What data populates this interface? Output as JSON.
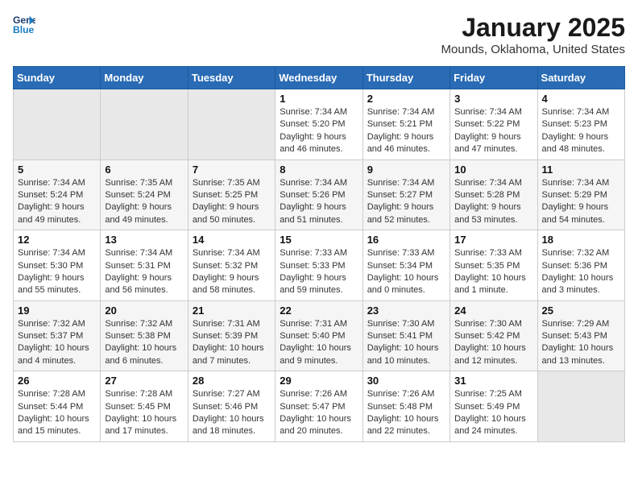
{
  "header": {
    "logo_line1": "General",
    "logo_line2": "Blue",
    "month": "January 2025",
    "location": "Mounds, Oklahoma, United States"
  },
  "weekdays": [
    "Sunday",
    "Monday",
    "Tuesday",
    "Wednesday",
    "Thursday",
    "Friday",
    "Saturday"
  ],
  "weeks": [
    [
      {
        "day": "",
        "info": ""
      },
      {
        "day": "",
        "info": ""
      },
      {
        "day": "",
        "info": ""
      },
      {
        "day": "1",
        "info": "Sunrise: 7:34 AM\nSunset: 5:20 PM\nDaylight: 9 hours\nand 46 minutes."
      },
      {
        "day": "2",
        "info": "Sunrise: 7:34 AM\nSunset: 5:21 PM\nDaylight: 9 hours\nand 46 minutes."
      },
      {
        "day": "3",
        "info": "Sunrise: 7:34 AM\nSunset: 5:22 PM\nDaylight: 9 hours\nand 47 minutes."
      },
      {
        "day": "4",
        "info": "Sunrise: 7:34 AM\nSunset: 5:23 PM\nDaylight: 9 hours\nand 48 minutes."
      }
    ],
    [
      {
        "day": "5",
        "info": "Sunrise: 7:34 AM\nSunset: 5:24 PM\nDaylight: 9 hours\nand 49 minutes."
      },
      {
        "day": "6",
        "info": "Sunrise: 7:35 AM\nSunset: 5:24 PM\nDaylight: 9 hours\nand 49 minutes."
      },
      {
        "day": "7",
        "info": "Sunrise: 7:35 AM\nSunset: 5:25 PM\nDaylight: 9 hours\nand 50 minutes."
      },
      {
        "day": "8",
        "info": "Sunrise: 7:34 AM\nSunset: 5:26 PM\nDaylight: 9 hours\nand 51 minutes."
      },
      {
        "day": "9",
        "info": "Sunrise: 7:34 AM\nSunset: 5:27 PM\nDaylight: 9 hours\nand 52 minutes."
      },
      {
        "day": "10",
        "info": "Sunrise: 7:34 AM\nSunset: 5:28 PM\nDaylight: 9 hours\nand 53 minutes."
      },
      {
        "day": "11",
        "info": "Sunrise: 7:34 AM\nSunset: 5:29 PM\nDaylight: 9 hours\nand 54 minutes."
      }
    ],
    [
      {
        "day": "12",
        "info": "Sunrise: 7:34 AM\nSunset: 5:30 PM\nDaylight: 9 hours\nand 55 minutes."
      },
      {
        "day": "13",
        "info": "Sunrise: 7:34 AM\nSunset: 5:31 PM\nDaylight: 9 hours\nand 56 minutes."
      },
      {
        "day": "14",
        "info": "Sunrise: 7:34 AM\nSunset: 5:32 PM\nDaylight: 9 hours\nand 58 minutes."
      },
      {
        "day": "15",
        "info": "Sunrise: 7:33 AM\nSunset: 5:33 PM\nDaylight: 9 hours\nand 59 minutes."
      },
      {
        "day": "16",
        "info": "Sunrise: 7:33 AM\nSunset: 5:34 PM\nDaylight: 10 hours\nand 0 minutes."
      },
      {
        "day": "17",
        "info": "Sunrise: 7:33 AM\nSunset: 5:35 PM\nDaylight: 10 hours\nand 1 minute."
      },
      {
        "day": "18",
        "info": "Sunrise: 7:32 AM\nSunset: 5:36 PM\nDaylight: 10 hours\nand 3 minutes."
      }
    ],
    [
      {
        "day": "19",
        "info": "Sunrise: 7:32 AM\nSunset: 5:37 PM\nDaylight: 10 hours\nand 4 minutes."
      },
      {
        "day": "20",
        "info": "Sunrise: 7:32 AM\nSunset: 5:38 PM\nDaylight: 10 hours\nand 6 minutes."
      },
      {
        "day": "21",
        "info": "Sunrise: 7:31 AM\nSunset: 5:39 PM\nDaylight: 10 hours\nand 7 minutes."
      },
      {
        "day": "22",
        "info": "Sunrise: 7:31 AM\nSunset: 5:40 PM\nDaylight: 10 hours\nand 9 minutes."
      },
      {
        "day": "23",
        "info": "Sunrise: 7:30 AM\nSunset: 5:41 PM\nDaylight: 10 hours\nand 10 minutes."
      },
      {
        "day": "24",
        "info": "Sunrise: 7:30 AM\nSunset: 5:42 PM\nDaylight: 10 hours\nand 12 minutes."
      },
      {
        "day": "25",
        "info": "Sunrise: 7:29 AM\nSunset: 5:43 PM\nDaylight: 10 hours\nand 13 minutes."
      }
    ],
    [
      {
        "day": "26",
        "info": "Sunrise: 7:28 AM\nSunset: 5:44 PM\nDaylight: 10 hours\nand 15 minutes."
      },
      {
        "day": "27",
        "info": "Sunrise: 7:28 AM\nSunset: 5:45 PM\nDaylight: 10 hours\nand 17 minutes."
      },
      {
        "day": "28",
        "info": "Sunrise: 7:27 AM\nSunset: 5:46 PM\nDaylight: 10 hours\nand 18 minutes."
      },
      {
        "day": "29",
        "info": "Sunrise: 7:26 AM\nSunset: 5:47 PM\nDaylight: 10 hours\nand 20 minutes."
      },
      {
        "day": "30",
        "info": "Sunrise: 7:26 AM\nSunset: 5:48 PM\nDaylight: 10 hours\nand 22 minutes."
      },
      {
        "day": "31",
        "info": "Sunrise: 7:25 AM\nSunset: 5:49 PM\nDaylight: 10 hours\nand 24 minutes."
      },
      {
        "day": "",
        "info": ""
      }
    ]
  ]
}
